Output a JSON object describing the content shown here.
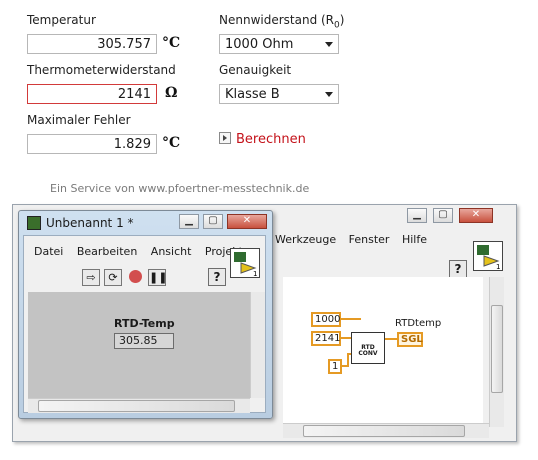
{
  "calculator": {
    "temperature": {
      "label": "Temperatur",
      "value": "305.757",
      "unit": "°C"
    },
    "resistance": {
      "label": "Thermometerwiderstand",
      "value": "2141",
      "unit": "Ω"
    },
    "max_error": {
      "label": "Maximaler Fehler",
      "value": "1.829",
      "unit": "°C"
    },
    "nominal": {
      "label": "Nennwiderstand (R",
      "label_sub": "0",
      "label_close": ")",
      "selected": "1000 Ohm"
    },
    "accuracy": {
      "label": "Genauigkeit",
      "selected": "Klasse B"
    },
    "calc_button": "Berechnen",
    "credit": "Ein Service von www.pfoertner-messtechnik.de"
  },
  "back_window": {
    "menu": [
      "Werkzeuge",
      "Fenster",
      "Hilfe"
    ],
    "help": "?",
    "diagram": {
      "constants": [
        "1000",
        "2141",
        "1"
      ],
      "node_label": "RTD\nCONV",
      "output_label": "RTDtemp",
      "output_type": "SGL"
    }
  },
  "front_window": {
    "title": "Unbenannt 1 *",
    "menu": [
      "Datei",
      "Bearbeiten",
      "Ansicht",
      "Projekt"
    ],
    "help": "?",
    "indicator_label": "RTD-Temp",
    "indicator_value": "305.85"
  },
  "colors": {
    "error_border": "#d23a3a",
    "link": "#c4121a",
    "wire": "#e59a24"
  }
}
